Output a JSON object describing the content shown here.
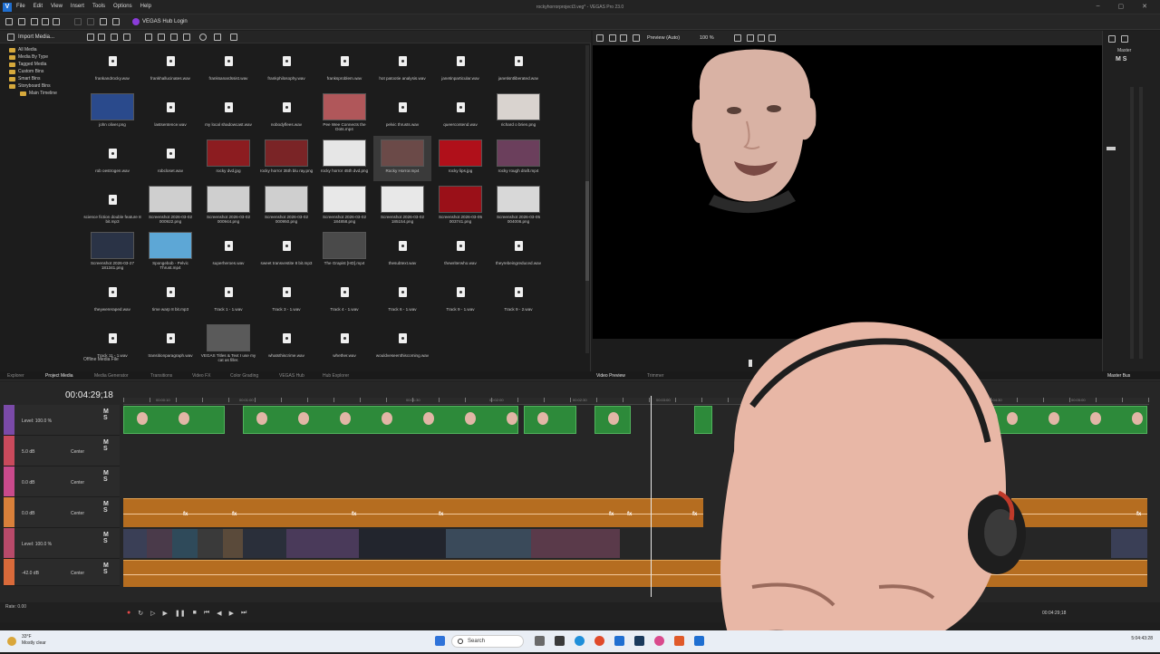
{
  "app": {
    "logo": "V",
    "window_title": "rockyhorrorproject3.veg* - VEGAS Pro 23.0",
    "menus": [
      "File",
      "Edit",
      "View",
      "Insert",
      "Tools",
      "Options",
      "Help"
    ],
    "hub_login": "VEGAS Hub Login",
    "window_controls": [
      "–",
      "▢",
      "✕"
    ]
  },
  "media": {
    "import_label": "Import Media...",
    "tree": [
      {
        "label": "All Media",
        "indent": 1
      },
      {
        "label": "Media By Type",
        "indent": 1
      },
      {
        "label": "Tagged Media",
        "indent": 1
      },
      {
        "label": "Custom Bins",
        "indent": 1
      },
      {
        "label": "Smart Bins",
        "indent": 1
      },
      {
        "label": "Storyboard Bins",
        "indent": 1
      },
      {
        "label": "Main Timeline",
        "indent": 2
      }
    ],
    "items": [
      {
        "label": "frankandrocky.wav",
        "kind": "audio"
      },
      {
        "label": "frankhallucinates.wav",
        "kind": "audio"
      },
      {
        "label": "franksanardssist.wav",
        "kind": "audio"
      },
      {
        "label": "frankphilosophy.wav",
        "kind": "audio"
      },
      {
        "label": "franksproblem.wav",
        "kind": "audio"
      },
      {
        "label": "hot patootie analysis.wav",
        "kind": "audio"
      },
      {
        "label": "janetinparticular.wav",
        "kind": "audio"
      },
      {
        "label": "janetisntliberated.wav",
        "kind": "audio"
      },
      {
        "label": "john oliver.png",
        "kind": "image",
        "color": "#2a4a8c"
      },
      {
        "label": "lastsentence.wav",
        "kind": "audio"
      },
      {
        "label": "my local shadowcast.wav",
        "kind": "audio"
      },
      {
        "label": "nobodyflees.wav",
        "kind": "audio"
      },
      {
        "label": "Pee Wee Connects the Dots.mp4",
        "kind": "image",
        "color": "#b0575a"
      },
      {
        "label": "pelvic thrusts.wav",
        "kind": "audio"
      },
      {
        "label": "queercontend.wav",
        "kind": "audio"
      },
      {
        "label": "richard o brien.png",
        "kind": "image",
        "color": "#d9d3cf"
      },
      {
        "label": "rob oestrogen.wav",
        "kind": "audio"
      },
      {
        "label": "robcloset.wav",
        "kind": "audio"
      },
      {
        "label": "rocky dvd.jpg",
        "kind": "image",
        "color": "#8c1c20"
      },
      {
        "label": "rocky horror 35th blu ray.png",
        "kind": "image",
        "color": "#7a2426"
      },
      {
        "label": "rocky horror 45th dvd.png",
        "kind": "image",
        "color": "#e6e6e6"
      },
      {
        "label": "Rocky Horror.mp4",
        "kind": "image",
        "color": "#6b4a48"
      },
      {
        "label": "rocky lips.jpg",
        "kind": "image",
        "color": "#b0101a"
      },
      {
        "label": "rocky rough draft.mp4",
        "kind": "image",
        "color": "#6b3f5c"
      },
      {
        "label": "science fiction double feature 8 bit.mp3",
        "kind": "audio"
      },
      {
        "label": "Screenshot 2026-03-02 000922.png",
        "kind": "image",
        "color": "#cfcfcf"
      },
      {
        "label": "Screenshot 2026-03-02 000944.png",
        "kind": "image",
        "color": "#cfcfcf"
      },
      {
        "label": "Screenshot 2026-03-02 000950.png",
        "kind": "image",
        "color": "#cfcfcf"
      },
      {
        "label": "Screenshot 2026-03-02 184858.png",
        "kind": "image",
        "color": "#e8e8e8"
      },
      {
        "label": "Screenshot 2026-03-02 185154.png",
        "kind": "image",
        "color": "#e8e8e8"
      },
      {
        "label": "Screenshot 2026-03-05 003741.png",
        "kind": "image",
        "color": "#9a1018"
      },
      {
        "label": "Screenshot 2026-03-05 004006.png",
        "kind": "image",
        "color": "#d8d8d8"
      },
      {
        "label": "Screenshot 2026-03-27 181341.png",
        "kind": "image",
        "color": "#2a3346"
      },
      {
        "label": "Spongebob - Pelvic Thrust.mp4",
        "kind": "image",
        "color": "#5da7d6"
      },
      {
        "label": "superheroes.wav",
        "kind": "audio"
      },
      {
        "label": "sweet transvestite 8 bit.mp3",
        "kind": "audio"
      },
      {
        "label": "The Grapist [HD].mp4",
        "kind": "image",
        "color": "#4a4a4a"
      },
      {
        "label": "thesubtext.wav",
        "kind": "audio"
      },
      {
        "label": "thewriterwho.wav",
        "kind": "audio"
      },
      {
        "label": "theyrebeingreduced.wav",
        "kind": "audio"
      },
      {
        "label": "theywereraped.wav",
        "kind": "audio"
      },
      {
        "label": "time warp 8 bit.mp3",
        "kind": "audio"
      },
      {
        "label": "Track 1 - 1.wav",
        "kind": "audio"
      },
      {
        "label": "Track 3 - 1.wav",
        "kind": "audio"
      },
      {
        "label": "Track 4 - 1.wav",
        "kind": "audio"
      },
      {
        "label": "Track 6 - 1.wav",
        "kind": "audio"
      },
      {
        "label": "Track 9 - 1.wav",
        "kind": "audio"
      },
      {
        "label": "Track 9 - 2.wav",
        "kind": "audio"
      },
      {
        "label": "Track 11 - 1.wav",
        "kind": "audio"
      },
      {
        "label": "transitionparagraph.wav",
        "kind": "audio"
      },
      {
        "label": "VEGAS Titles & Text I use my cat as filler.",
        "kind": "image",
        "color": "#5a5a5a"
      },
      {
        "label": "whatsthiscrime.wav",
        "kind": "audio"
      },
      {
        "label": "whether.wav",
        "kind": "audio"
      },
      {
        "label": "wouldveseenthiscoming.wav",
        "kind": "audio"
      }
    ],
    "selected_index": 21,
    "offline_label": "Offline Media File"
  },
  "tabs": {
    "left": [
      "Explorer",
      "Project Media",
      "Media Generator",
      "Transitions",
      "Video FX",
      "Color Grading",
      "VEGAS Hub",
      "Hub Explorer"
    ],
    "left_active": 1,
    "right": [
      "Video Preview",
      "Trimmer"
    ],
    "right_active": 0,
    "master": "Master Bus"
  },
  "preview": {
    "mode": "Preview (Auto)",
    "zoom": "100 %"
  },
  "master": {
    "label": "Master",
    "ms": "M S"
  },
  "timeline": {
    "timecode": "00:04:29;18",
    "ruler_labels": [
      "00:00:10",
      "00:01:00",
      "00:01:30",
      "00:02:00",
      "00:02:30",
      "00:03:00",
      "00:04:30",
      "00:05:00"
    ],
    "tracks": [
      {
        "level": "Level: 100.0 %",
        "pan": "",
        "color": "#7a4aa8",
        "ms": "M S"
      },
      {
        "level": "5.0 dB",
        "pan": "Center",
        "color": "#c94a5c",
        "ms": "M S"
      },
      {
        "level": "0.0 dB",
        "pan": "Center",
        "color": "#c94a8c",
        "ms": "M S"
      },
      {
        "level": "0.0 dB",
        "pan": "Center",
        "color": "#d9803a",
        "ms": "M S"
      },
      {
        "level": "Level: 100.0 %",
        "pan": "",
        "color": "#b84a6a",
        "ms": "M S"
      },
      {
        "level": "-42.0 dB",
        "pan": "Center",
        "color": "#d96a3a",
        "ms": "M S"
      }
    ],
    "rate": "Rate: 0.00",
    "end_timecode": "00:04:29;18",
    "fx_label": "fx"
  },
  "taskbar": {
    "weather_temp": "33°F",
    "weather_desc": "Mostly clear",
    "search_placeholder": "Search",
    "clock": "5:04:43:28"
  }
}
